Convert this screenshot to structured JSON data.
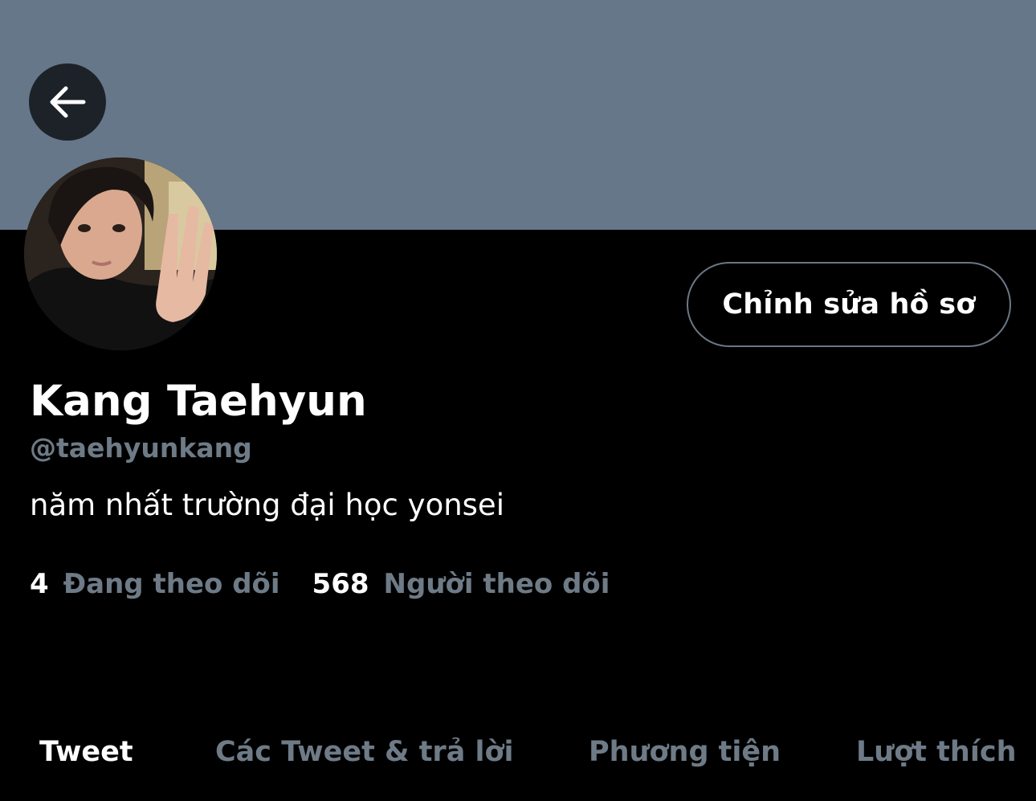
{
  "colors": {
    "background": "#000000",
    "banner": "#66778a",
    "text_primary": "#ffffff",
    "text_secondary": "#6e7b87",
    "button_border": "#6b7784"
  },
  "header": {
    "back_icon": "arrow-left-icon"
  },
  "profile": {
    "edit_button_label": "Chỉnh sửa hồ sơ",
    "display_name": "Kang Taehyun",
    "handle": "@taehyunkang",
    "bio": "năm nhất trường đại học yonsei",
    "following_count": "4",
    "following_label": "Đang theo dõi",
    "followers_count": "568",
    "followers_label": "Người theo dõi"
  },
  "tabs": [
    {
      "label": "Tweet",
      "active": true
    },
    {
      "label": "Các Tweet & trả lời",
      "active": false
    },
    {
      "label": "Phương tiện",
      "active": false
    },
    {
      "label": "Lượt thích",
      "active": false
    }
  ]
}
